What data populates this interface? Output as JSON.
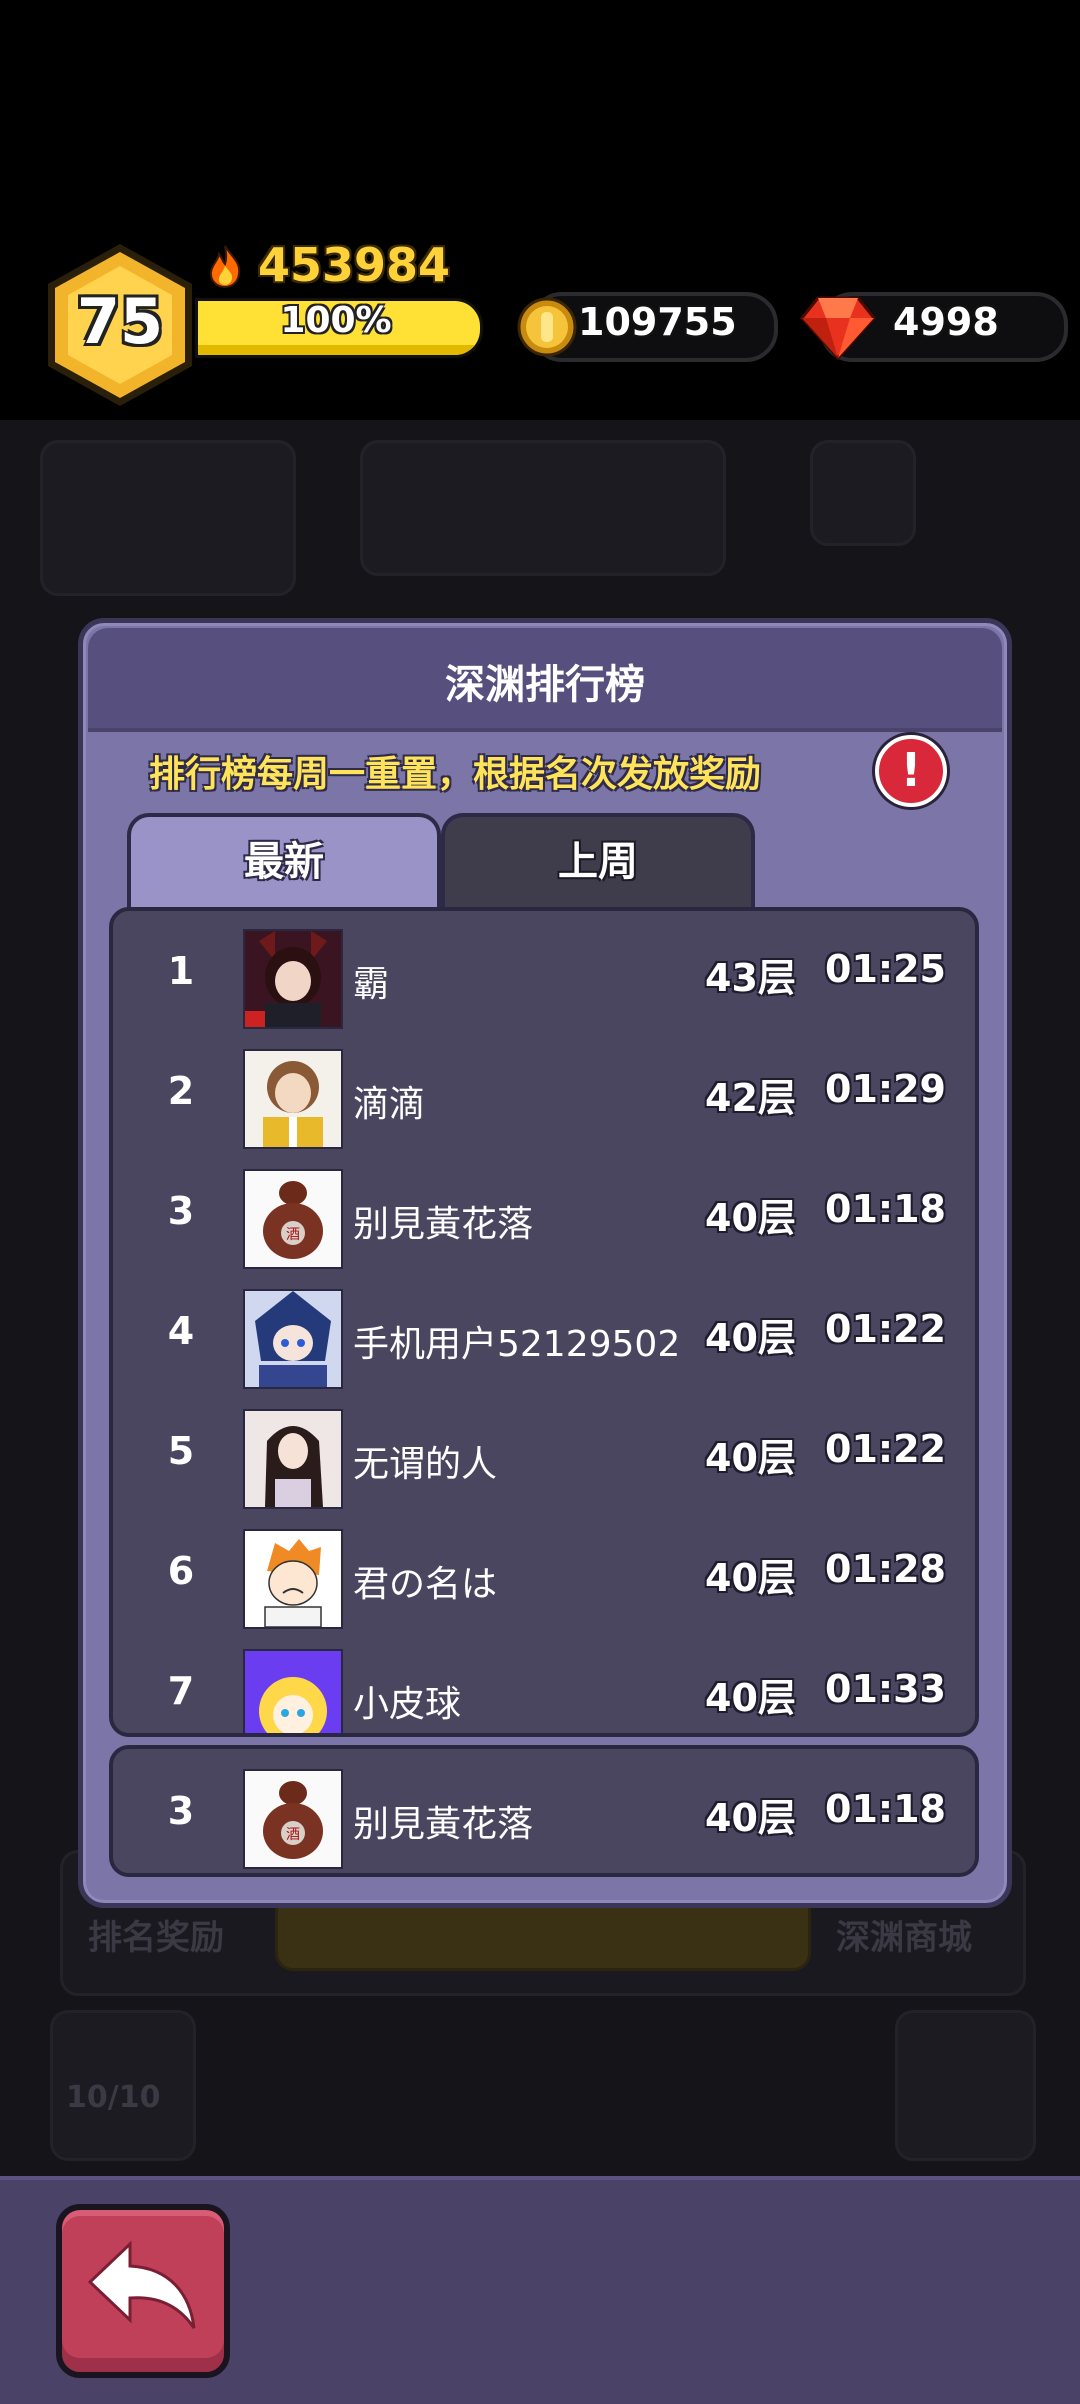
{
  "hud": {
    "level": "75",
    "power": "453984",
    "xp_percent_label": "100%",
    "xp_fraction": 1.0,
    "coins": "109755",
    "gems": "4998"
  },
  "background": {
    "rank_reward_label": "排名奖励",
    "shop_label": "深渊商城",
    "counter_label": "10/10"
  },
  "dialog": {
    "title": "深渊排行榜",
    "notice": "排行榜每周一重置，根据名次发放奖励",
    "info_icon": "!",
    "tabs": [
      {
        "label": "最新",
        "active": true
      },
      {
        "label": "上周",
        "active": false
      }
    ],
    "rows": [
      {
        "rank": "1",
        "name": "霸",
        "floor": "43层",
        "time": "01:25",
        "avatar": "avatar-fox-girl"
      },
      {
        "rank": "2",
        "name": "滴滴",
        "floor": "42层",
        "time": "01:29",
        "avatar": "avatar-uniform-girl"
      },
      {
        "rank": "3",
        "name": "别見黃花落",
        "floor": "40层",
        "time": "01:18",
        "avatar": "avatar-wine-jar"
      },
      {
        "rank": "4",
        "name": "手机用户52129502",
        "floor": "40层",
        "time": "01:22",
        "avatar": "avatar-blue-chibi"
      },
      {
        "rank": "5",
        "name": "无谓的人",
        "floor": "40层",
        "time": "01:22",
        "avatar": "avatar-longhair-girl"
      },
      {
        "rank": "6",
        "name": "君の名は",
        "floor": "40层",
        "time": "01:28",
        "avatar": "avatar-orange-boy"
      },
      {
        "rank": "7",
        "name": "小皮球",
        "floor": "40层",
        "time": "01:33",
        "avatar": "avatar-purple-blonde"
      }
    ],
    "self_row": {
      "rank": "3",
      "name": "别見黃花落",
      "floor": "40层",
      "time": "01:18",
      "avatar": "avatar-wine-jar"
    }
  },
  "colors": {
    "accent_gold": "#ffd23a",
    "dialog_bg": "#7b75a8",
    "list_bg": "#4a4660",
    "back_button": "#c0405a"
  }
}
